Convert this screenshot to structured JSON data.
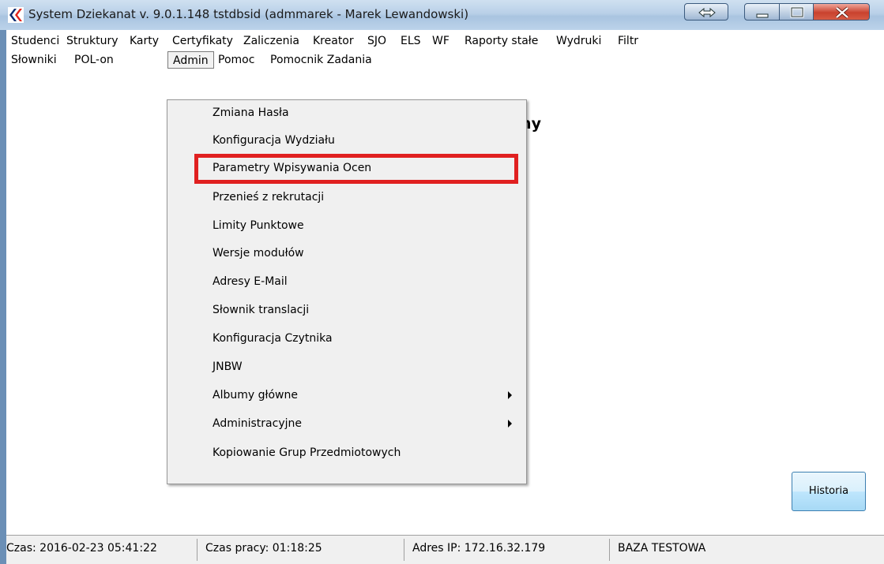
{
  "window": {
    "title": "System Dziekanat v. 9.0.1.148  tstdbsid  (admmarek - Marek Lewandowski)"
  },
  "menu": {
    "row1": [
      "Studenci",
      "Struktury",
      "Karty",
      "Certyfikaty",
      "Zaliczenia",
      "Kreator",
      "SJO",
      "ELS",
      "WF",
      "Raporty stałe",
      "Wydruki",
      "Filtr"
    ],
    "row2": [
      "Słowniki",
      "POL-on",
      "Admin",
      "Pomoc",
      "Pomocnik Zadania"
    ]
  },
  "content": {
    "heading_fragment": "zny"
  },
  "dropdown": {
    "items": [
      {
        "label": "Zmiana Hasła",
        "submenu": false
      },
      {
        "label": "Konfiguracja Wydziału",
        "submenu": false
      },
      {
        "label": "Parametry Wpisywania Ocen",
        "submenu": false
      },
      {
        "label": "Przenieś z rekrutacji",
        "submenu": false
      },
      {
        "label": "Limity Punktowe",
        "submenu": false
      },
      {
        "label": "Wersje modułów",
        "submenu": false
      },
      {
        "label": "Adresy E-Mail",
        "submenu": false
      },
      {
        "label": "Słownik translacji",
        "submenu": false
      },
      {
        "label": "Konfiguracja Czytnika",
        "submenu": false
      },
      {
        "label": "JNBW",
        "submenu": false
      },
      {
        "label": "Albumy główne",
        "submenu": true
      },
      {
        "label": "Administracyjne",
        "submenu": true
      },
      {
        "label": "Kopiowanie Grup Przedmiotowych",
        "submenu": false
      }
    ]
  },
  "buttons": {
    "historia": "Historia"
  },
  "status": {
    "czas": "Czas: 2016-02-23 05:41:22",
    "czas_pracy": "Czas pracy: 01:18:25",
    "adres_ip": "Adres IP: 172.16.32.179",
    "baza": "BAZA TESTOWA"
  },
  "colors": {
    "highlight": "#e02020",
    "close_button": "#c9422e"
  }
}
